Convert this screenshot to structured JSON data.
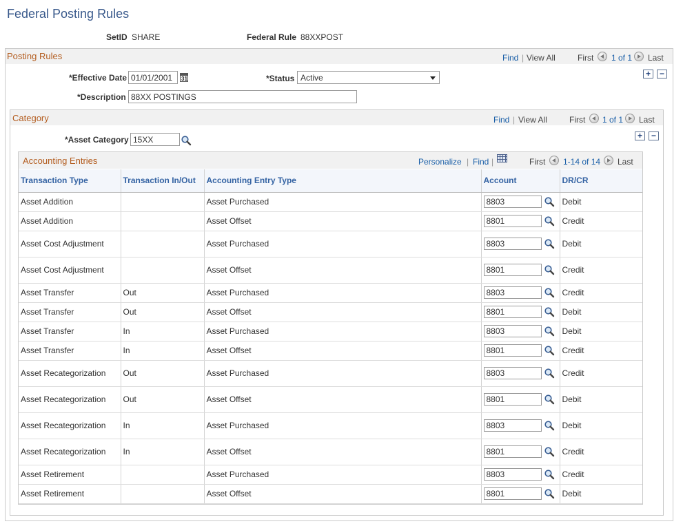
{
  "page": {
    "title": "Federal Posting Rules"
  },
  "keys": {
    "setid_label": "SetID",
    "setid_value": "SHARE",
    "rule_label": "Federal Rule",
    "rule_value": "88XXPOST"
  },
  "posting_rules": {
    "title": "Posting Rules",
    "find": "Find",
    "view_all": "View All",
    "first": "First",
    "range": "1 of 1",
    "last": "Last",
    "effective_date_label": "*Effective Date",
    "effective_date": "01/01/2001",
    "status_label": "*Status",
    "status": "Active",
    "description_label": "*Description",
    "description": "88XX POSTINGS",
    "add": "+",
    "remove": "−"
  },
  "category": {
    "title": "Category",
    "find": "Find",
    "view_all": "View All",
    "first": "First",
    "range": "1 of 1",
    "last": "Last",
    "asset_category_label": "*Asset Category",
    "asset_category": "15XX",
    "add": "+",
    "remove": "−"
  },
  "accounting_entries": {
    "title": "Accounting Entries",
    "personalize": "Personalize",
    "find": "Find",
    "first": "First",
    "range": "1-14 of 14",
    "last": "Last",
    "columns": [
      "Transaction Type",
      "Transaction In/Out",
      "Accounting Entry Type",
      "Account",
      "DR/CR"
    ],
    "rows": [
      {
        "type": "Asset Addition",
        "inout": "",
        "entry": "Asset Purchased",
        "account": "8803",
        "drcr": "Debit"
      },
      {
        "type": "Asset Addition",
        "inout": "",
        "entry": "Asset Offset",
        "account": "8801",
        "drcr": "Credit"
      },
      {
        "type": "Asset Cost Adjustment",
        "inout": "",
        "entry": "Asset Purchased",
        "account": "8803",
        "drcr": "Debit"
      },
      {
        "type": "Asset Cost Adjustment",
        "inout": "",
        "entry": "Asset Offset",
        "account": "8801",
        "drcr": "Credit"
      },
      {
        "type": "Asset Transfer",
        "inout": "Out",
        "entry": "Asset Purchased",
        "account": "8803",
        "drcr": "Credit"
      },
      {
        "type": "Asset Transfer",
        "inout": "Out",
        "entry": "Asset Offset",
        "account": "8801",
        "drcr": "Debit"
      },
      {
        "type": "Asset Transfer",
        "inout": "In",
        "entry": "Asset Purchased",
        "account": "8803",
        "drcr": "Debit"
      },
      {
        "type": "Asset Transfer",
        "inout": "In",
        "entry": "Asset Offset",
        "account": "8801",
        "drcr": "Credit"
      },
      {
        "type": "Asset Recategorization",
        "inout": "Out",
        "entry": "Asset Purchased",
        "account": "8803",
        "drcr": "Credit"
      },
      {
        "type": "Asset Recategorization",
        "inout": "Out",
        "entry": "Asset Offset",
        "account": "8801",
        "drcr": "Debit"
      },
      {
        "type": "Asset Recategorization",
        "inout": "In",
        "entry": "Asset Purchased",
        "account": "8803",
        "drcr": "Debit"
      },
      {
        "type": "Asset Recategorization",
        "inout": "In",
        "entry": "Asset Offset",
        "account": "8801",
        "drcr": "Credit"
      },
      {
        "type": "Asset Retirement",
        "inout": "",
        "entry": "Asset Purchased",
        "account": "8803",
        "drcr": "Credit"
      },
      {
        "type": "Asset Retirement",
        "inout": "",
        "entry": "Asset Offset",
        "account": "8801",
        "drcr": "Debit"
      }
    ]
  },
  "icons": {
    "lookup": "magnifier-icon",
    "calendar": "calendar-icon",
    "calendar_glyph": "31",
    "grid": "grid-icon"
  }
}
